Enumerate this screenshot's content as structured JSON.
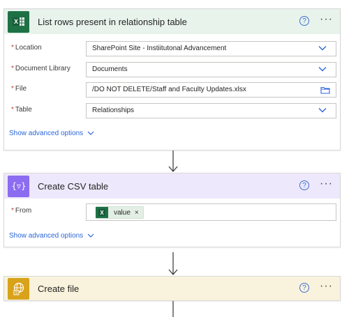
{
  "cards": {
    "list_rows": {
      "title": "List rows present in relationship table",
      "icon": "excel-icon",
      "header_bg": "#e8f3ec",
      "icon_bg": "#1e7145",
      "help_glyph": "?",
      "more_glyph": "···",
      "fields": [
        {
          "label": "Location",
          "value": "SharePoint Site - Instiitutonal Advancement",
          "control": "dropdown"
        },
        {
          "label": "Document Library",
          "value": "Documents",
          "control": "dropdown"
        },
        {
          "label": "File",
          "value": "/DO NOT DELETE/Staff and Faculty Updates.xlsx",
          "control": "file-picker"
        },
        {
          "label": "Table",
          "value": "Relationships",
          "control": "dropdown"
        }
      ],
      "advanced_label": "Show advanced options"
    },
    "create_csv": {
      "title": "Create CSV table",
      "icon": "data-operation-icon",
      "header_bg": "#ede8fb",
      "icon_bg": "#8c6cf0",
      "help_glyph": "?",
      "more_glyph": "···",
      "field_label": "From",
      "token_label": "value",
      "token_remove": "×",
      "advanced_label": "Show advanced options"
    },
    "create_file": {
      "title": "Create file",
      "icon": "sharepoint-globe-icon",
      "header_bg": "#f9f3dd",
      "icon_bg": "#d9a21b",
      "help_glyph": "?",
      "more_glyph": "···"
    }
  },
  "required_marker": "*",
  "accent": "#2a66d9"
}
